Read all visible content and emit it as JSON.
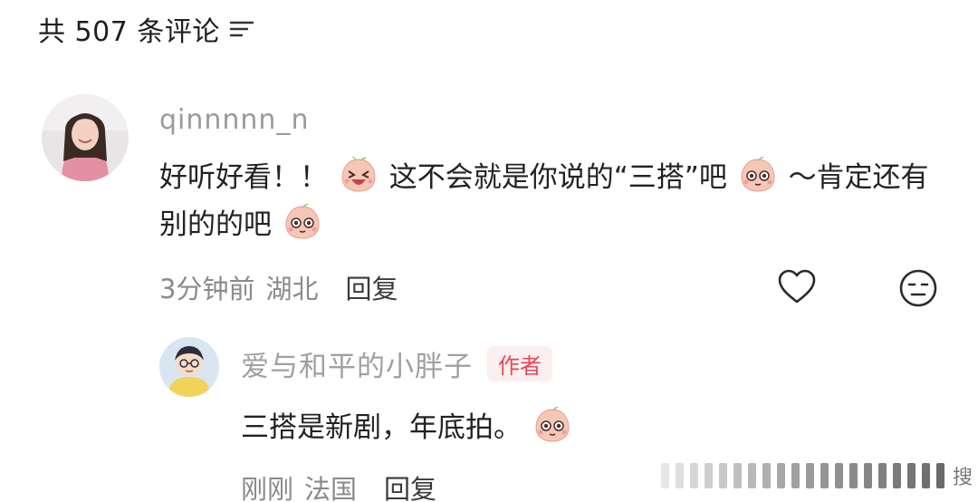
{
  "header": {
    "comment_count_text": "共 507 条评论",
    "sort_icon": "sort-lines-icon"
  },
  "comment": {
    "username": "qinnnnn_n",
    "text_part1": "好听好看！！",
    "text_part2": "这不会就是你说的“三搭”吧",
    "text_part3": "～肯定还有别的的吧",
    "time": "3分钟前",
    "location": "湖北",
    "reply_label": "回复",
    "like_icon": "heart-outline-icon",
    "dislike_icon": "meh-face-icon"
  },
  "reply": {
    "username": "爱与和平的小胖子",
    "author_tag": "作者",
    "text": "三搭是新剧，年底拍。",
    "time": "刚刚",
    "location": "法国",
    "reply_label": "回复"
  },
  "watermark": {
    "partial_text": "搜"
  },
  "colors": {
    "author_tag_text": "#e24a59",
    "author_tag_bg": "#fbeff0",
    "meta_text": "#8a8a8a",
    "username": "#9a9a9a"
  }
}
